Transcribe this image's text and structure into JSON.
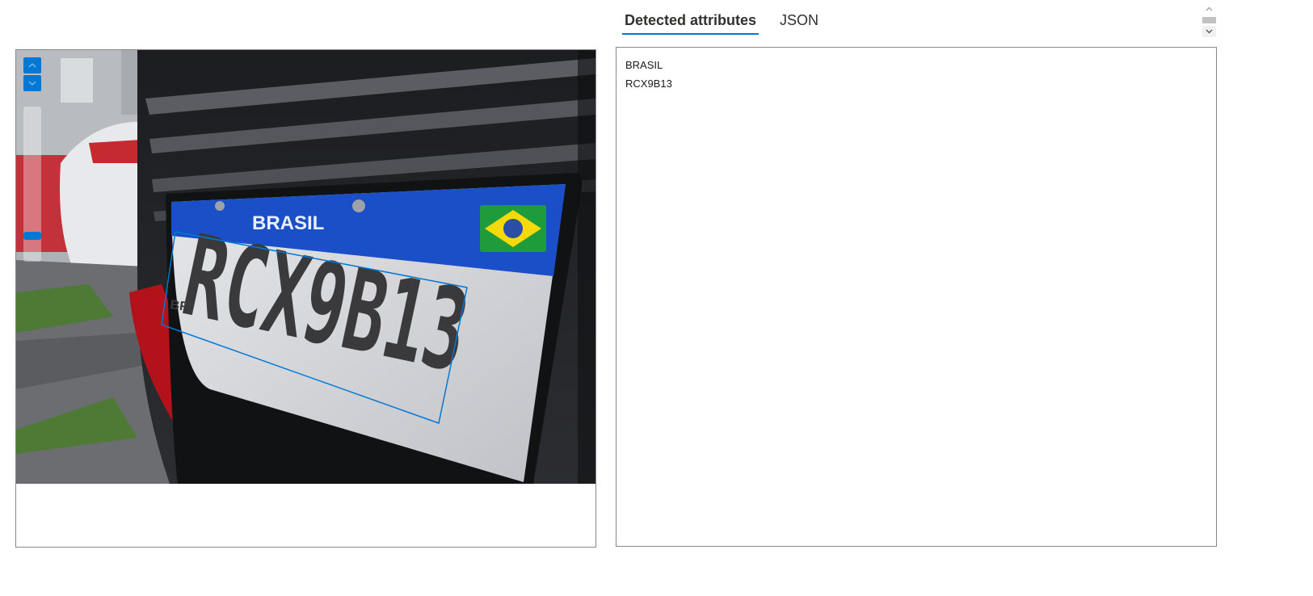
{
  "tabs": [
    {
      "label": "Detected attributes",
      "active": true
    },
    {
      "label": "JSON",
      "active": false
    }
  ],
  "image": {
    "plate_banner_text": "BRASIL",
    "plate_number": "RCX9B13",
    "plate_country_code": "BR",
    "highlight_color": "#0078d4"
  },
  "zoom": {
    "zoom_in_icon": "chevron-up-icon",
    "zoom_out_icon": "chevron-down-icon",
    "level": 0.15
  },
  "attributes": [
    "BRASIL",
    "RCX9B13"
  ],
  "colors": {
    "accent": "#0078d4",
    "border": "#8a8886",
    "plate_blue": "#1a4fc7",
    "bumper_red": "#b3121a"
  }
}
